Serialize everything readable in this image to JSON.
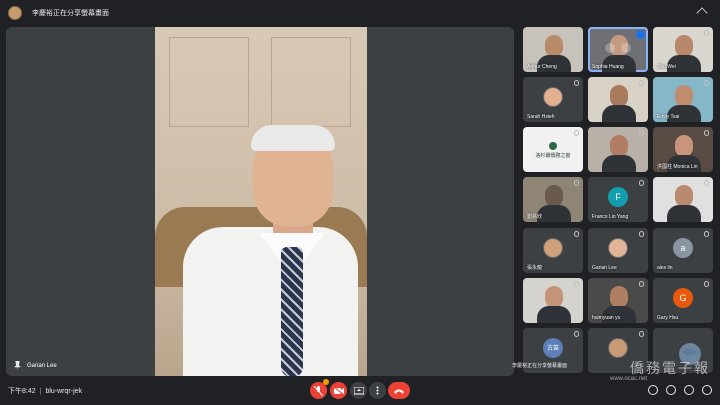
{
  "top_bar": {
    "presenting_text": "李慶裕正在分享螢幕畫面"
  },
  "main": {
    "speaker_name": "Garian Lee"
  },
  "participants": [
    {
      "name": "Arthur Cheng",
      "kind": "photo",
      "bg": "#c8c3ba",
      "face": "#b88a6a"
    },
    {
      "name": "Sophia Huang",
      "kind": "photo",
      "bg": "#6f7076",
      "face": "#c49b80",
      "active": true
    },
    {
      "name": "Shu Wei",
      "kind": "photo",
      "bg": "#d9d6cf",
      "face": "#b9876a"
    },
    {
      "name": "Sarah Hsieh",
      "kind": "avatar-photo",
      "bg": "#3c4043",
      "face": "#e0b090"
    },
    {
      "name": "",
      "kind": "photo",
      "bg": "#d8d2c7",
      "face": "#a77a5c"
    },
    {
      "name": "Emily Tsai",
      "kind": "photo",
      "bg": "#86b7c9",
      "face": "#c08c6e"
    },
    {
      "name": "",
      "kind": "logo",
      "bg": "#f1f1f1",
      "logo_text": "洛杉磯僑務之窗",
      "face": "#2e6a45"
    },
    {
      "name": "",
      "kind": "photo",
      "bg": "#b7b1a8",
      "face": "#b27d62"
    },
    {
      "name": "洪國柱 Monica Lin",
      "kind": "photo",
      "bg": "#5a4a44",
      "face": "#c8947a"
    },
    {
      "name": "劉易欣",
      "kind": "photo",
      "bg": "#8f8574",
      "face": "#6a5a4a"
    },
    {
      "name": "Franco Lin Yang",
      "kind": "letter",
      "bg": "#3c4043",
      "letter": "F",
      "letter_bg": "#129eaf"
    },
    {
      "name": "",
      "kind": "photo",
      "bg": "#e0e0e0",
      "face": "#b98a6e"
    },
    {
      "name": "張永龍",
      "kind": "avatar-photo",
      "bg": "#3c4043",
      "face": "#d0a07a"
    },
    {
      "name": "Garian Lee",
      "kind": "avatar-photo",
      "bg": "#3c4043",
      "face": "#e2b498"
    },
    {
      "name": "alex lin",
      "kind": "letter",
      "bg": "#3c4043",
      "letter": "a",
      "letter_bg": "#8a95a3"
    },
    {
      "name": "",
      "kind": "photo",
      "bg": "#d5d3ce",
      "face": "#c49478"
    },
    {
      "name": "huimyuan yu",
      "kind": "photo",
      "bg": "#4a4a4a",
      "face": "#b07e62"
    },
    {
      "name": "Gary Hsu",
      "kind": "letter",
      "bg": "#3c4043",
      "letter": "G",
      "letter_bg": "#e8590c"
    },
    {
      "name": "",
      "kind": "letter",
      "bg": "#3c4043",
      "letter": "古笛",
      "letter_bg": "#5c7fb8"
    },
    {
      "name": "",
      "kind": "avatar-photo",
      "bg": "#3c4043",
      "face": "#c89a76"
    },
    {
      "name": "",
      "kind": "empty",
      "bg": "#3c4043"
    }
  ],
  "bottom_bar": {
    "time": "下午8:42",
    "separator": "|",
    "meeting_code": "blu-wrqr-jek",
    "toast": "李慶裕正在分享螢幕畫面"
  },
  "watermark": {
    "text": "僑務電子報",
    "url": "www.ocac.net"
  },
  "colors": {
    "background": "#202124",
    "tile": "#3c4043",
    "danger": "#ea4335",
    "active": "#8ab4f8"
  }
}
